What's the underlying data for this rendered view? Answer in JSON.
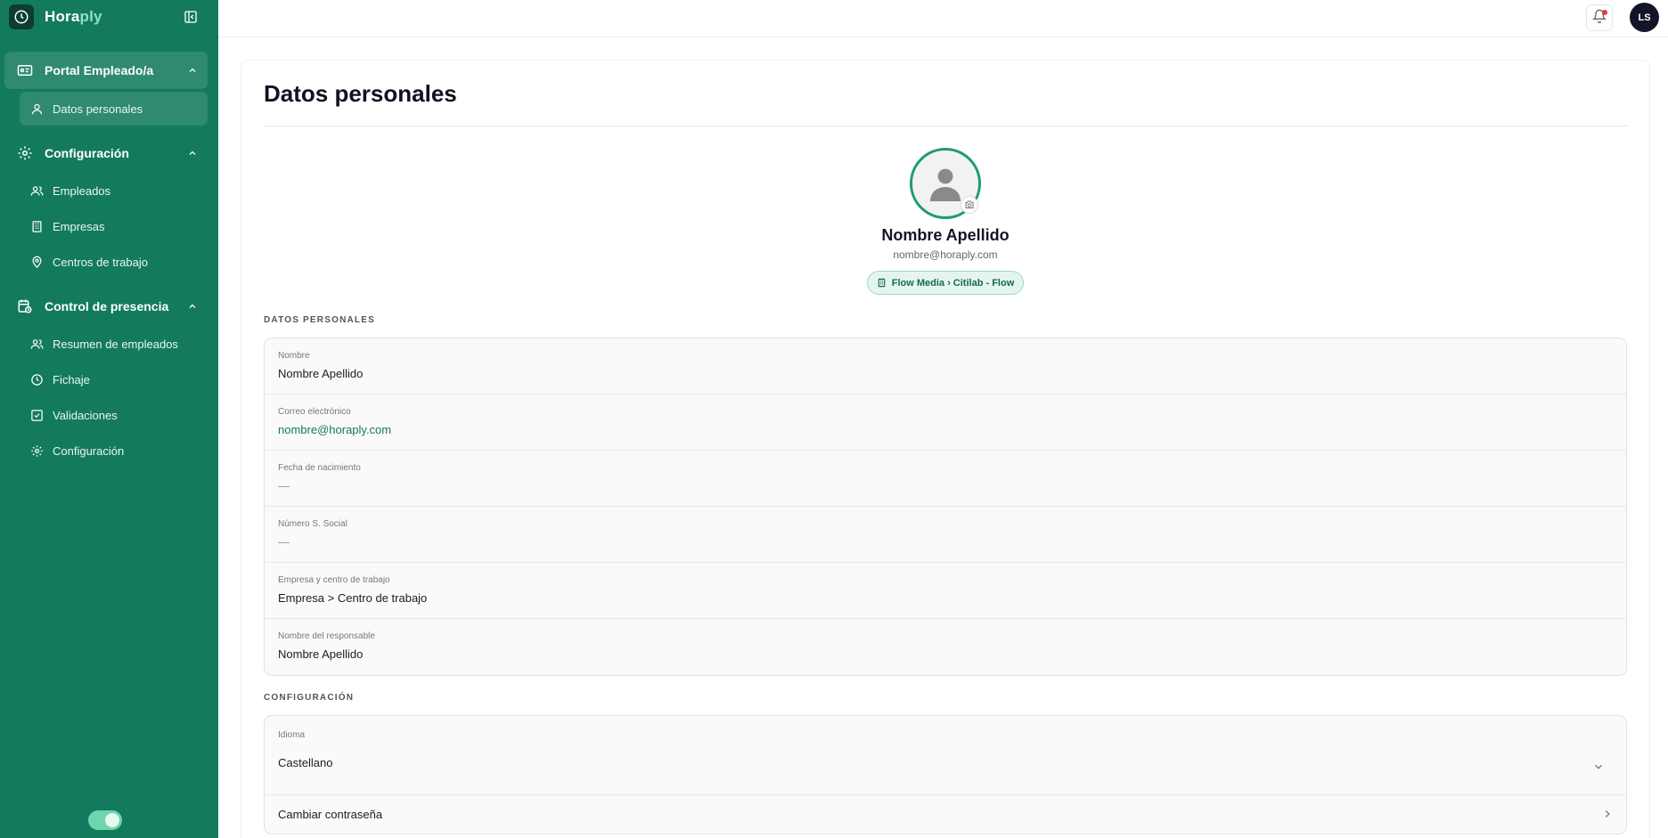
{
  "brand": {
    "name_main": "Hora",
    "name_accent": "ply"
  },
  "sidebar": {
    "sections": [
      {
        "label": "Portal Empleado/a",
        "items": [
          {
            "label": "Datos personales"
          }
        ]
      },
      {
        "label": "Configuración",
        "items": [
          {
            "label": "Empleados"
          },
          {
            "label": "Empresas"
          },
          {
            "label": "Centros de trabajo"
          }
        ]
      },
      {
        "label": "Control de presencia",
        "items": [
          {
            "label": "Resumen de empleados"
          },
          {
            "label": "Fichaje"
          },
          {
            "label": "Validaciones"
          },
          {
            "label": "Configuración"
          }
        ]
      }
    ]
  },
  "topbar": {
    "user_initials": "LS"
  },
  "page": {
    "title": "Datos personales",
    "profile": {
      "name": "Nombre Apellido",
      "email": "nombre@horaply.com",
      "org": "Flow Media › Citilab - Flow"
    },
    "personal_section_label": "DATOS PERSONALES",
    "fields": [
      {
        "label": "Nombre",
        "value": "Nombre Apellido"
      },
      {
        "label": "Correo electrónico",
        "value": "nombre@horaply.com"
      },
      {
        "label": "Fecha de nacimiento",
        "value": "—"
      },
      {
        "label": "Número S. Social",
        "value": "—"
      },
      {
        "label": "Empresa y centro de trabajo",
        "value": "Empresa > Centro de trabajo"
      },
      {
        "label": "Nombre del responsable",
        "value": "Nombre Apellido"
      }
    ],
    "config_section_label": "CONFIGURACIÓN",
    "language": {
      "label": "Idioma",
      "value": "Castellano"
    },
    "change_password": "Cambiar contraseña"
  },
  "colors": {
    "sidebar_bg": "#137a5e",
    "accent": "#1f9a73",
    "active_item": "#2f8a6f",
    "notification_dot": "#e53935"
  }
}
